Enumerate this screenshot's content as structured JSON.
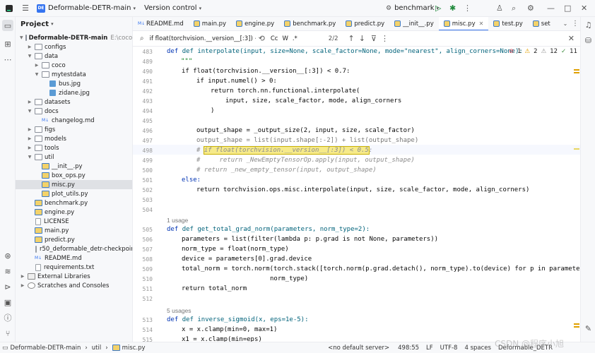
{
  "topbar": {
    "project_badge": "DE",
    "project_name": "Deformable-DETR-main",
    "vcs": "Version control",
    "run_config": "benchmark"
  },
  "project_panel": {
    "title": "Project",
    "root_name": "Deformable-DETR-main",
    "root_path": "E:\\coco\\De",
    "rows": [
      {
        "label": "configs"
      },
      {
        "label": "data"
      },
      {
        "label": "coco"
      },
      {
        "label": "mytestdata"
      },
      {
        "label": "bus.jpg"
      },
      {
        "label": "zidane.jpg"
      },
      {
        "label": "datasets"
      },
      {
        "label": "docs"
      },
      {
        "label": "changelog.md"
      },
      {
        "label": "figs"
      },
      {
        "label": "models"
      },
      {
        "label": "tools"
      },
      {
        "label": "util"
      },
      {
        "label": "__init__.py"
      },
      {
        "label": "box_ops.py"
      },
      {
        "label": "misc.py"
      },
      {
        "label": "plot_utils.py"
      },
      {
        "label": "benchmark.py"
      },
      {
        "label": "engine.py"
      },
      {
        "label": "LICENSE"
      },
      {
        "label": "main.py"
      },
      {
        "label": "predict.py"
      },
      {
        "label": "r50_deformable_detr-checkpoint.p"
      },
      {
        "label": "README.md"
      },
      {
        "label": "requirements.txt"
      },
      {
        "label": "External Libraries"
      },
      {
        "label": "Scratches and Consoles"
      }
    ]
  },
  "tabs": [
    {
      "label": "README.md"
    },
    {
      "label": "main.py"
    },
    {
      "label": "engine.py"
    },
    {
      "label": "benchmark.py"
    },
    {
      "label": "predict.py"
    },
    {
      "label": "__init__.py"
    },
    {
      "label": "misc.py"
    },
    {
      "label": "test.py"
    },
    {
      "label": "set"
    }
  ],
  "find": {
    "query": "if float(torchvision.__version__[:3]) < 0.5",
    "case_label": "Cc",
    "word_label": "W",
    "regex_label": ".*",
    "match_count": "2/2"
  },
  "inspections": {
    "errors": "1",
    "warnings": "2",
    "weak": "12",
    "typos": "11"
  },
  "editor": {
    "line_numbers": [
      "483",
      "489",
      "490",
      "491",
      "492",
      "493",
      "494",
      "495",
      "496",
      "497",
      "498",
      "499",
      "500",
      "501",
      "502",
      "503",
      "504",
      "",
      "505",
      "506",
      "507",
      "508",
      "509",
      "510",
      "511",
      "512",
      "",
      "513",
      "514",
      "515"
    ],
    "usage_1": "1 usage",
    "usage_2": "5 usages",
    "line_483": "def interpolate(input, size=None, scale_factor=None, mode=\"nearest\", align_corners=None):",
    "line_489": "\"\"\"",
    "line_490": "if float(torchvision.__version__[:3]) < 0.7:",
    "line_491": "if input.numel() > 0:",
    "line_492": "return torch.nn.functional.interpolate(",
    "line_493": "input, size, scale_factor, mode, align_corners",
    "line_494": ")",
    "line_496": "output_shape = _output_size(2, input, size, scale_factor)",
    "line_497": "output_shape = list(input.shape[:-2]) + list(output_shape)",
    "line_498_hash": "# ",
    "line_498_hl": "if float(torchvision.__version__[:3]) < 0.5",
    "line_498_tail": ":",
    "line_499": "#     return _NewEmptyTensorOp.apply(input, output_shape)",
    "line_500": "# return _new_empty_tensor(input, output_shape)",
    "line_501": "else:",
    "line_502": "return torchvision.ops.misc.interpolate(input, size, scale_factor, mode, align_corners)",
    "line_505": "def get_total_grad_norm(parameters, norm_type=2):",
    "line_506": "parameters = list(filter(lambda p: p.grad is not None, parameters))",
    "line_507": "norm_type = float(norm_type)",
    "line_508": "device = parameters[0].grad.device",
    "line_509": "total_norm = torch.norm(torch.stack([torch.norm(p.grad.detach(), norm_type).to(device) for p in parameters]),",
    "line_510": "norm_type)",
    "line_511": "return total_norm",
    "line_513": "def inverse_sigmoid(x, eps=1e-5):",
    "line_514": "x = x.clamp(min=0, max=1)",
    "line_515": "x1 = x.clamp(min=eps)"
  },
  "statusbar": {
    "crumb_project": "Deformable-DETR-main",
    "crumb_folder": "util",
    "crumb_file": "misc.py",
    "interpreter": "<no default server>",
    "position": "498:55",
    "line_sep": "LF",
    "encoding": "UTF-8",
    "indent": "4 spaces",
    "project_short": "Deformable_DETR"
  },
  "watermark": "CSDN @程序小旭",
  "colors": {
    "accent": "#3574f0",
    "highlight": "#f6ea8a"
  }
}
